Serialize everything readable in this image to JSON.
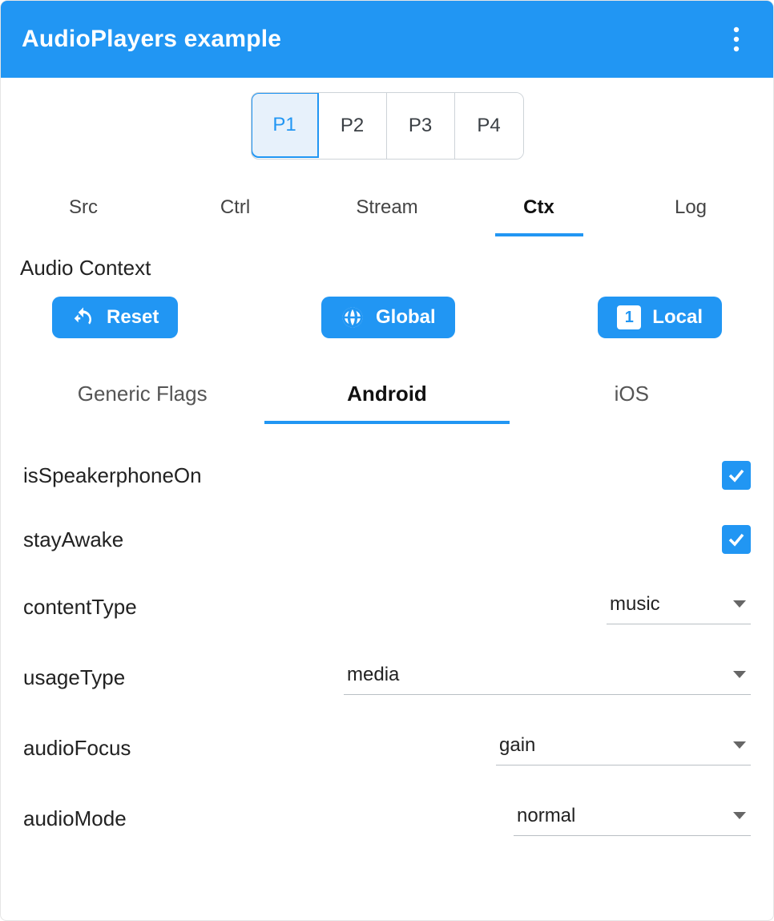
{
  "header": {
    "title": "AudioPlayers example"
  },
  "playerTabs": [
    {
      "label": "P1",
      "selected": true
    },
    {
      "label": "P2",
      "selected": false
    },
    {
      "label": "P3",
      "selected": false
    },
    {
      "label": "P4",
      "selected": false
    }
  ],
  "mainTabs": [
    {
      "label": "Src",
      "active": false
    },
    {
      "label": "Ctrl",
      "active": false
    },
    {
      "label": "Stream",
      "active": false
    },
    {
      "label": "Ctx",
      "active": true
    },
    {
      "label": "Log",
      "active": false
    }
  ],
  "section": {
    "title": "Audio Context"
  },
  "actions": {
    "reset": "Reset",
    "global": "Global",
    "local": "Local",
    "local_icon_text": "1"
  },
  "platformTabs": [
    {
      "label": "Generic Flags",
      "active": false
    },
    {
      "label": "Android",
      "active": true
    },
    {
      "label": "iOS",
      "active": false
    }
  ],
  "android": {
    "isSpeakerphoneOn": {
      "label": "isSpeakerphoneOn",
      "checked": true
    },
    "stayAwake": {
      "label": "stayAwake",
      "checked": true
    },
    "contentType": {
      "label": "contentType",
      "value": "music"
    },
    "usageType": {
      "label": "usageType",
      "value": "media"
    },
    "audioFocus": {
      "label": "audioFocus",
      "value": "gain"
    },
    "audioMode": {
      "label": "audioMode",
      "value": "normal"
    }
  }
}
